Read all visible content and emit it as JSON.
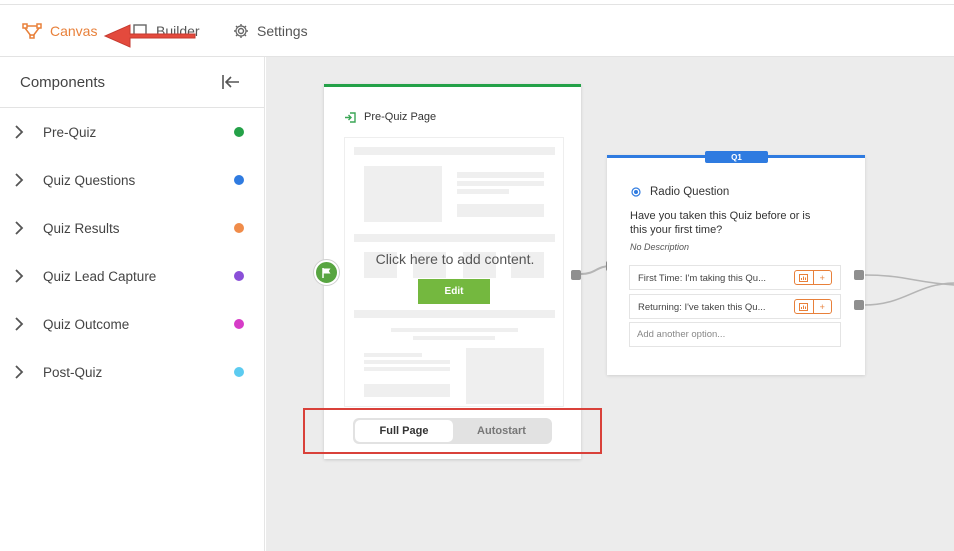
{
  "nav": {
    "tabs": [
      {
        "label": "Canvas",
        "icon": "vector-path-icon",
        "active": true
      },
      {
        "label": "Builder",
        "icon": "builder-icon"
      },
      {
        "label": "Settings",
        "icon": "gear-icon"
      }
    ],
    "active_color": "#e8803a"
  },
  "sidebar": {
    "title": "Components",
    "items": [
      {
        "label": "Pre-Quiz",
        "color": "#24a148"
      },
      {
        "label": "Quiz Questions",
        "color": "#2f7be0"
      },
      {
        "label": "Quiz Results",
        "color": "#f08c4a"
      },
      {
        "label": "Quiz Lead Capture",
        "color": "#8a4fd8"
      },
      {
        "label": "Quiz Outcome",
        "color": "#d63cc7"
      },
      {
        "label": "Post-Quiz",
        "color": "#5ccbf0"
      }
    ]
  },
  "pre_quiz_card": {
    "title": "Pre-Quiz Page",
    "placeholder": "Click here to add content.",
    "edit_label": "Edit",
    "toggle": {
      "option_full": "Full Page",
      "option_auto": "Autostart",
      "selected": "Full Page"
    }
  },
  "question_card": {
    "badge": "Q1",
    "type_label": "Radio Question",
    "question": "Have you taken this Quiz before or is this your first time?",
    "description": "No Description",
    "options": [
      {
        "text": "First Time: I'm taking this Qu..."
      },
      {
        "text": "Returning: I've taken this Qu..."
      }
    ],
    "add_option_placeholder": "Add another option...",
    "plus": "+"
  }
}
